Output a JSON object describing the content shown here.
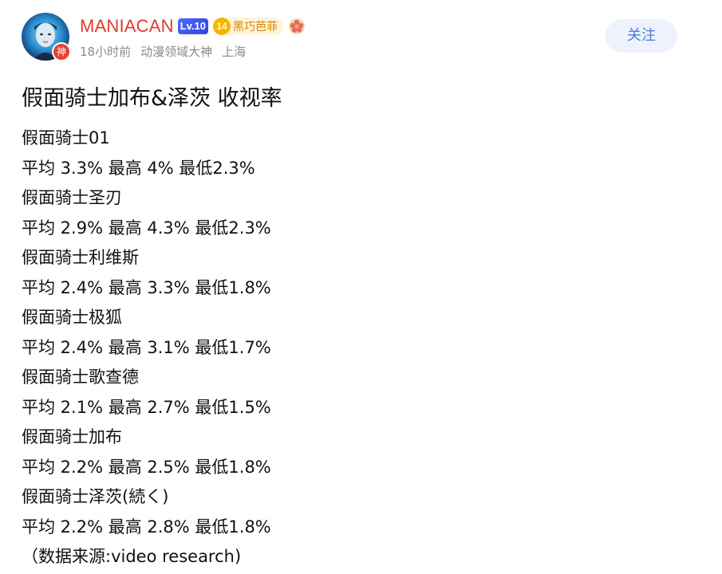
{
  "user": {
    "name": "MANIACAN",
    "level": "Lv.10",
    "fan_level": "14",
    "fan_name": "黑巧芭菲",
    "god_badge": "神",
    "time": "18小时前",
    "title": "动漫领域大神",
    "location": "上海",
    "follow_label": "关注"
  },
  "post": {
    "title": "假面骑士加布&泽茨 收视率",
    "lines": [
      "假面骑士01",
      "平均 3.3% 最高 4% 最低2.3%",
      "假面骑士圣刃",
      "平均 2.9% 最高 4.3% 最低2.3%",
      "假面骑士利维斯",
      "平均 2.4% 最高 3.3% 最低1.8%",
      "假面骑士极狐",
      "平均 2.4% 最高 3.1% 最低1.7%",
      "假面骑士歌查德",
      "平均 2.1% 最高 2.7% 最低1.5%",
      "假面骑士加布",
      "平均 2.2% 最高 2.5% 最低1.8%",
      "假面骑士泽茨(続く)",
      "平均 2.2% 最高 2.8% 最低1.8%"
    ],
    "source": "（数据来源:video research)"
  },
  "icons": {
    "avatar": "avatar-portrait",
    "medal": "flower-medal-icon"
  },
  "colors": {
    "username": "#e03a2f",
    "level_badge": "#3a55f0",
    "fan_badge": "#f5b400",
    "follow_bg": "#edf2fc",
    "follow_text": "#4a7cd8",
    "meta_text": "#8a8a8a"
  }
}
